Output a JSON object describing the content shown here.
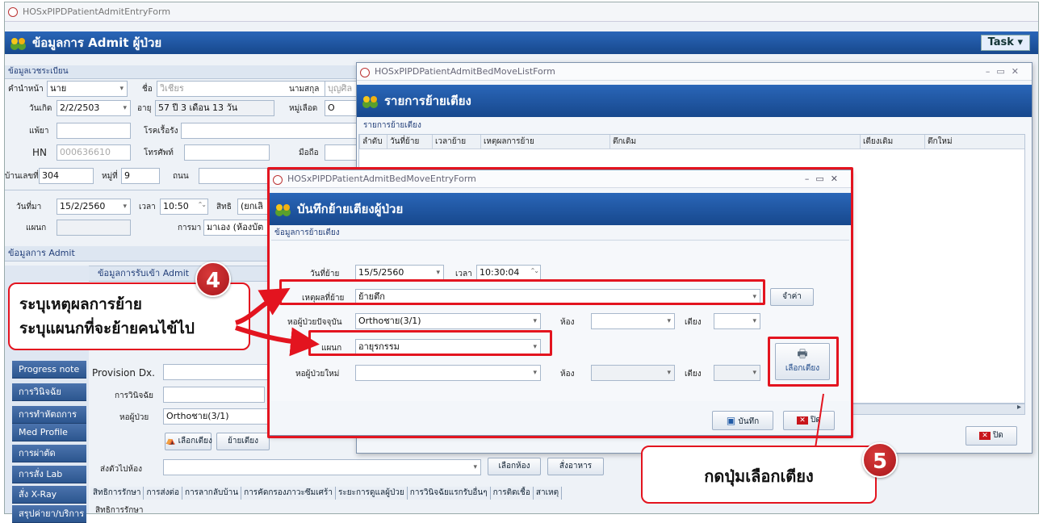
{
  "main": {
    "title_bar": "HOSxPIPDPatientAdmitEntryForm",
    "header": "ข้อมูลการ Admit ผู้ป่วย",
    "task_label": "Task",
    "reg_section": "ข้อมูลเวชระเบียน",
    "prefix_label": "คำนำหน้า",
    "prefix_value": "นาย",
    "name_label": "ชื่อ",
    "name_value": "วิเชียร",
    "surname_label": "นามสกุล",
    "surname_value": "บุญศิล",
    "birth_label": "วันเกิด",
    "birth_value": "2/2/2503",
    "age_label": "อายุ",
    "age_value": "57 ปี 3 เดือน 13 วัน",
    "blood_label": "หมู่เลือด",
    "blood_value": "O",
    "allergy_label": "แพ้ยา",
    "chronic_label": "โรคเรื้อรัง",
    "hn_label": "HN",
    "hn_value": "000636610",
    "phone_label": "โทรศัพท์",
    "mobile_label": "มือถือ",
    "house_label": "บ้านเลขที่",
    "house_value": "304",
    "moo_label": "หมู่ที่",
    "moo_value": "9",
    "road_label": "ถนน",
    "arrive_date_label": "วันที่มา",
    "arrive_date_value": "15/2/2560",
    "arrive_time_label": "เวลา",
    "arrive_time_value": "10:50",
    "right_label": "สิทธิ",
    "right_value": "(ยกเลิ",
    "dept_label": "แผนก",
    "arrive_by_label": "การมา",
    "arrive_by_value": "มาเอง (ห้องบัต",
    "admit_section": "ข้อมูลการ Admit",
    "admit_tab": "ข้อมูลการรับเข้า Admit",
    "nav_items": [
      "Progress note",
      "การวินิจฉัย",
      "การทำหัตถการ",
      "Med Profile",
      "การผ่าตัด",
      "การสั่ง Lab",
      "สั่ง X-Ray",
      "สรุปค่ายา/บริการ"
    ],
    "provision_label": "Provision Dx.",
    "diag_label": "การวินิจฉัย",
    "ward_label": "หอผู้ป่วย",
    "ward_value": "Orthoชาย(3/1)",
    "select_bed_btn": "เลือกเตียง",
    "move_bed_btn": "ย้ายเตียง",
    "send_room_label": "ส่งตัวไปห้อง",
    "select_room_btn": "เลือกห้อง",
    "order_food_btn": "สั่งอาหาร",
    "bottom_tabs": [
      "สิทธิการรักษา",
      "การส่งต่อ",
      "การลากลับบ้าน",
      "การคัดกรองภาวะซึมเศร้า",
      "ระยะการดูแลผู้ป่วย",
      "การวินิจฉัยแรกรับอื่นๆ",
      "การติดเชื้อ",
      "สาเหตุ"
    ],
    "bottom_sub": "สิทธิการรักษา"
  },
  "list_form": {
    "title_bar": "HOSxPIPDPatientAdmitBedMoveListForm",
    "header": "รายการย้ายเตียง",
    "section": "รายการย้ายเตียง",
    "columns": [
      "ลำดับ",
      "วันที่ย้าย",
      "เวลาย้าย",
      "เหตุผลการย้าย",
      "ตึกเดิม",
      "เตียงเดิม",
      "ตึกใหม่"
    ],
    "close_btn": "ปิด"
  },
  "entry_form": {
    "title_bar": "HOSxPIPDPatientAdmitBedMoveEntryForm",
    "header": "บันทึกย้ายเตียงผู้ป่วย",
    "section": "ข้อมูลการย้ายเตียง",
    "move_date_label": "วันที่ย้าย",
    "move_date_value": "15/5/2560",
    "move_time_label": "เวลา",
    "move_time_value": "10:30:04",
    "reason_label": "เหตุผลที่ย้าย",
    "reason_value": "ย้ายตึก",
    "remember_btn": "จำค่า",
    "cur_ward_label": "หอผู้ป่วยปัจจุบัน",
    "cur_ward_value": "Orthoชาย(3/1)",
    "room_label": "ห้อง",
    "bed_label": "เตียง",
    "dept_label": "แผนก",
    "dept_value": "อายุรกรรม",
    "new_ward_label": "หอผู้ป่วยใหม่",
    "select_bed_btn": "เลือกเตียง",
    "save_btn": "บันทึก",
    "close_btn": "ปิด"
  },
  "annotations": {
    "step4": "4",
    "step4_line1": "ระบุเหตุผลการย้าย",
    "step4_line2": "ระบุแผนกที่จะย้ายคนไข้ไป",
    "step5": "5",
    "step5_text": "กดปุ่มเลือกเตียง"
  },
  "colors": {
    "accent_red": "#e3141f",
    "header_blue": "#1f5aa6"
  }
}
